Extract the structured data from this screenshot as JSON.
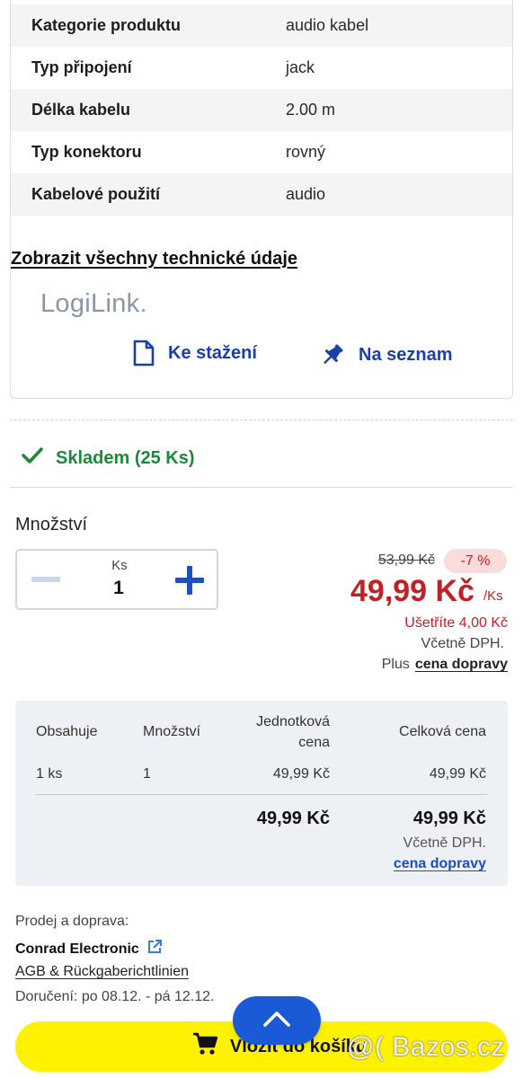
{
  "specs": [
    {
      "key": "Kategorie produktu",
      "value": "audio kabel"
    },
    {
      "key": "Typ připojení",
      "value": "jack"
    },
    {
      "key": "Délka kabelu",
      "value": "2.00 m"
    },
    {
      "key": "Typ konektoru",
      "value": "rovný"
    },
    {
      "key": "Kabelové použití",
      "value": "audio"
    }
  ],
  "all_specs_link": "Zobrazit všechny technické údaje",
  "brand": {
    "logo_text": "LogiLink",
    "logo_dot": "."
  },
  "actions": {
    "download": "Ke stažení",
    "add_to_list": "Na seznam"
  },
  "stock": {
    "label": "Skladem (25 Ks)"
  },
  "quantity": {
    "label": "Množství",
    "unit": "Ks",
    "value": "1"
  },
  "price": {
    "old": "53,99 Kč",
    "discount": "-7 %",
    "current": "49,99 Kč",
    "per_unit": "/Ks",
    "savings": "Ušetříte 4,00 Kč",
    "vat_note": "Včetně DPH.",
    "plus": "Plus",
    "shipping_link": "cena dopravy"
  },
  "package_table": {
    "headers": [
      "Obsahuje",
      "Množství",
      "Jednotková",
      "cena",
      "Celková cena"
    ],
    "row": [
      "1 ks",
      "1",
      "49,99 Kč",
      "49,99 Kč"
    ],
    "total_unit": "49,99 Kč",
    "total": "49,99 Kč",
    "vat_note": "Včetně DPH.",
    "shipping_link": "cena dopravy"
  },
  "seller": {
    "heading": "Prodej a doprava:",
    "name": "Conrad Electronic",
    "terms_link": "AGB & Rückgaberichtlinien",
    "delivery": "Doručení: po 08.12. - pá 12.12."
  },
  "cart_button": "Vložit do košíku",
  "watermark": "@( Bazos.cz",
  "colors": {
    "accent": "#1b4fc2",
    "price_red": "#c31f25",
    "stock_green": "#1a8a3a",
    "cart_yellow": "#fff200"
  }
}
